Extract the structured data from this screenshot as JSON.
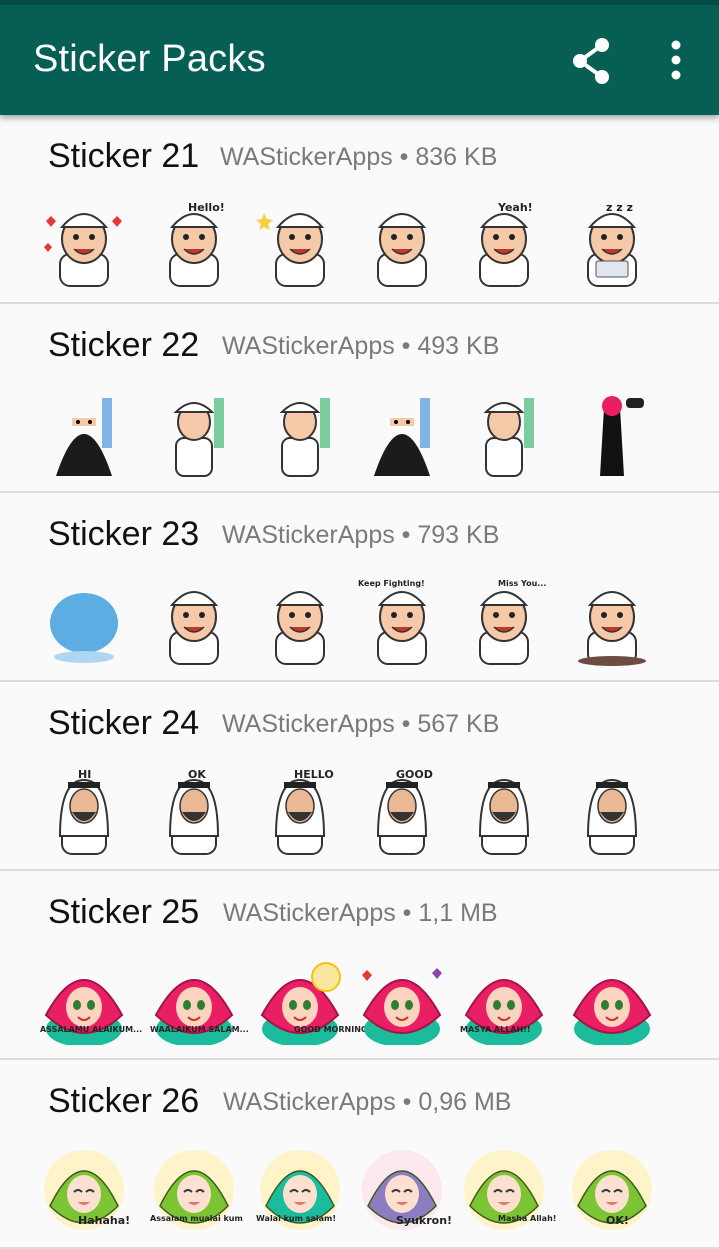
{
  "app_bar": {
    "title": "Sticker Packs",
    "share_icon": "share-icon",
    "menu_icon": "more-vert-icon",
    "color": "#075e54"
  },
  "packs": [
    {
      "name": "Sticker 21",
      "meta": "WAStickerApps • 836 KB",
      "stickers": [
        {
          "kind": "oldman-hearts",
          "caption": ""
        },
        {
          "kind": "oldman-wave",
          "caption": "Hello!"
        },
        {
          "kind": "oldman-wink",
          "caption": ""
        },
        {
          "kind": "oldman-angry",
          "caption": ""
        },
        {
          "kind": "oldman-yeah",
          "caption": "Yeah!"
        },
        {
          "kind": "oldman-sleep",
          "caption": "z z z"
        }
      ]
    },
    {
      "name": "Sticker 22",
      "meta": "WAStickerApps • 493 KB",
      "stickers": [
        {
          "kind": "woman-niqab-arabic",
          "caption": ""
        },
        {
          "kind": "man-arabic-cheer",
          "caption": ""
        },
        {
          "kind": "man-sleep-arabic",
          "caption": ""
        },
        {
          "kind": "woman-niqab-sleep",
          "caption": ""
        },
        {
          "kind": "man-standing-sign",
          "caption": ""
        },
        {
          "kind": "woman-standing-sign",
          "caption": ""
        }
      ]
    },
    {
      "name": "Sticker 23",
      "meta": "WAStickerApps • 793 KB",
      "stickers": [
        {
          "kind": "blue-splash",
          "caption": ""
        },
        {
          "kind": "oldman-laugh",
          "caption": ""
        },
        {
          "kind": "oldman-grin",
          "caption": ""
        },
        {
          "kind": "oldman-fight",
          "caption": "Keep Fighting!"
        },
        {
          "kind": "oldman-sit",
          "caption": "Miss You..."
        },
        {
          "kind": "oldman-cry",
          "caption": ""
        }
      ]
    },
    {
      "name": "Sticker 24",
      "meta": "WAStickerApps • 567 KB",
      "stickers": [
        {
          "kind": "arab-hi",
          "caption": "HI"
        },
        {
          "kind": "arab-ok",
          "caption": "OK"
        },
        {
          "kind": "arab-hello",
          "caption": "HELLO"
        },
        {
          "kind": "arab-good",
          "caption": "GOOD"
        },
        {
          "kind": "arab-pray",
          "caption": ""
        },
        {
          "kind": "arab-thumb",
          "caption": ""
        }
      ]
    },
    {
      "name": "Sticker 25",
      "meta": "WAStickerApps • 1,1 MB",
      "stickers": [
        {
          "kind": "hijab-pink",
          "caption": "ASSALAMU ALAIKUM..."
        },
        {
          "kind": "hijab-pink",
          "caption": "WAALAIKUM SALAM..."
        },
        {
          "kind": "hijab-pink-morning",
          "caption": "GOOD MORNING"
        },
        {
          "kind": "hijab-pink-hearts",
          "caption": ""
        },
        {
          "kind": "hijab-pink",
          "caption": "MASYA ALLAH!!"
        },
        {
          "kind": "hijab-pink-dots",
          "caption": ""
        }
      ]
    },
    {
      "name": "Sticker 26",
      "meta": "WAStickerApps • 0,96 MB",
      "stickers": [
        {
          "kind": "hijab-green",
          "caption": "Hahaha!"
        },
        {
          "kind": "hijab-green",
          "caption": "Assalam mualai kum"
        },
        {
          "kind": "hijab-teal",
          "caption": "Walai kum salam!"
        },
        {
          "kind": "hijab-purple",
          "caption": "Syukron!"
        },
        {
          "kind": "hijab-green",
          "caption": "Masha Allah!"
        },
        {
          "kind": "hijab-green-ok",
          "caption": "OK!"
        }
      ]
    }
  ]
}
